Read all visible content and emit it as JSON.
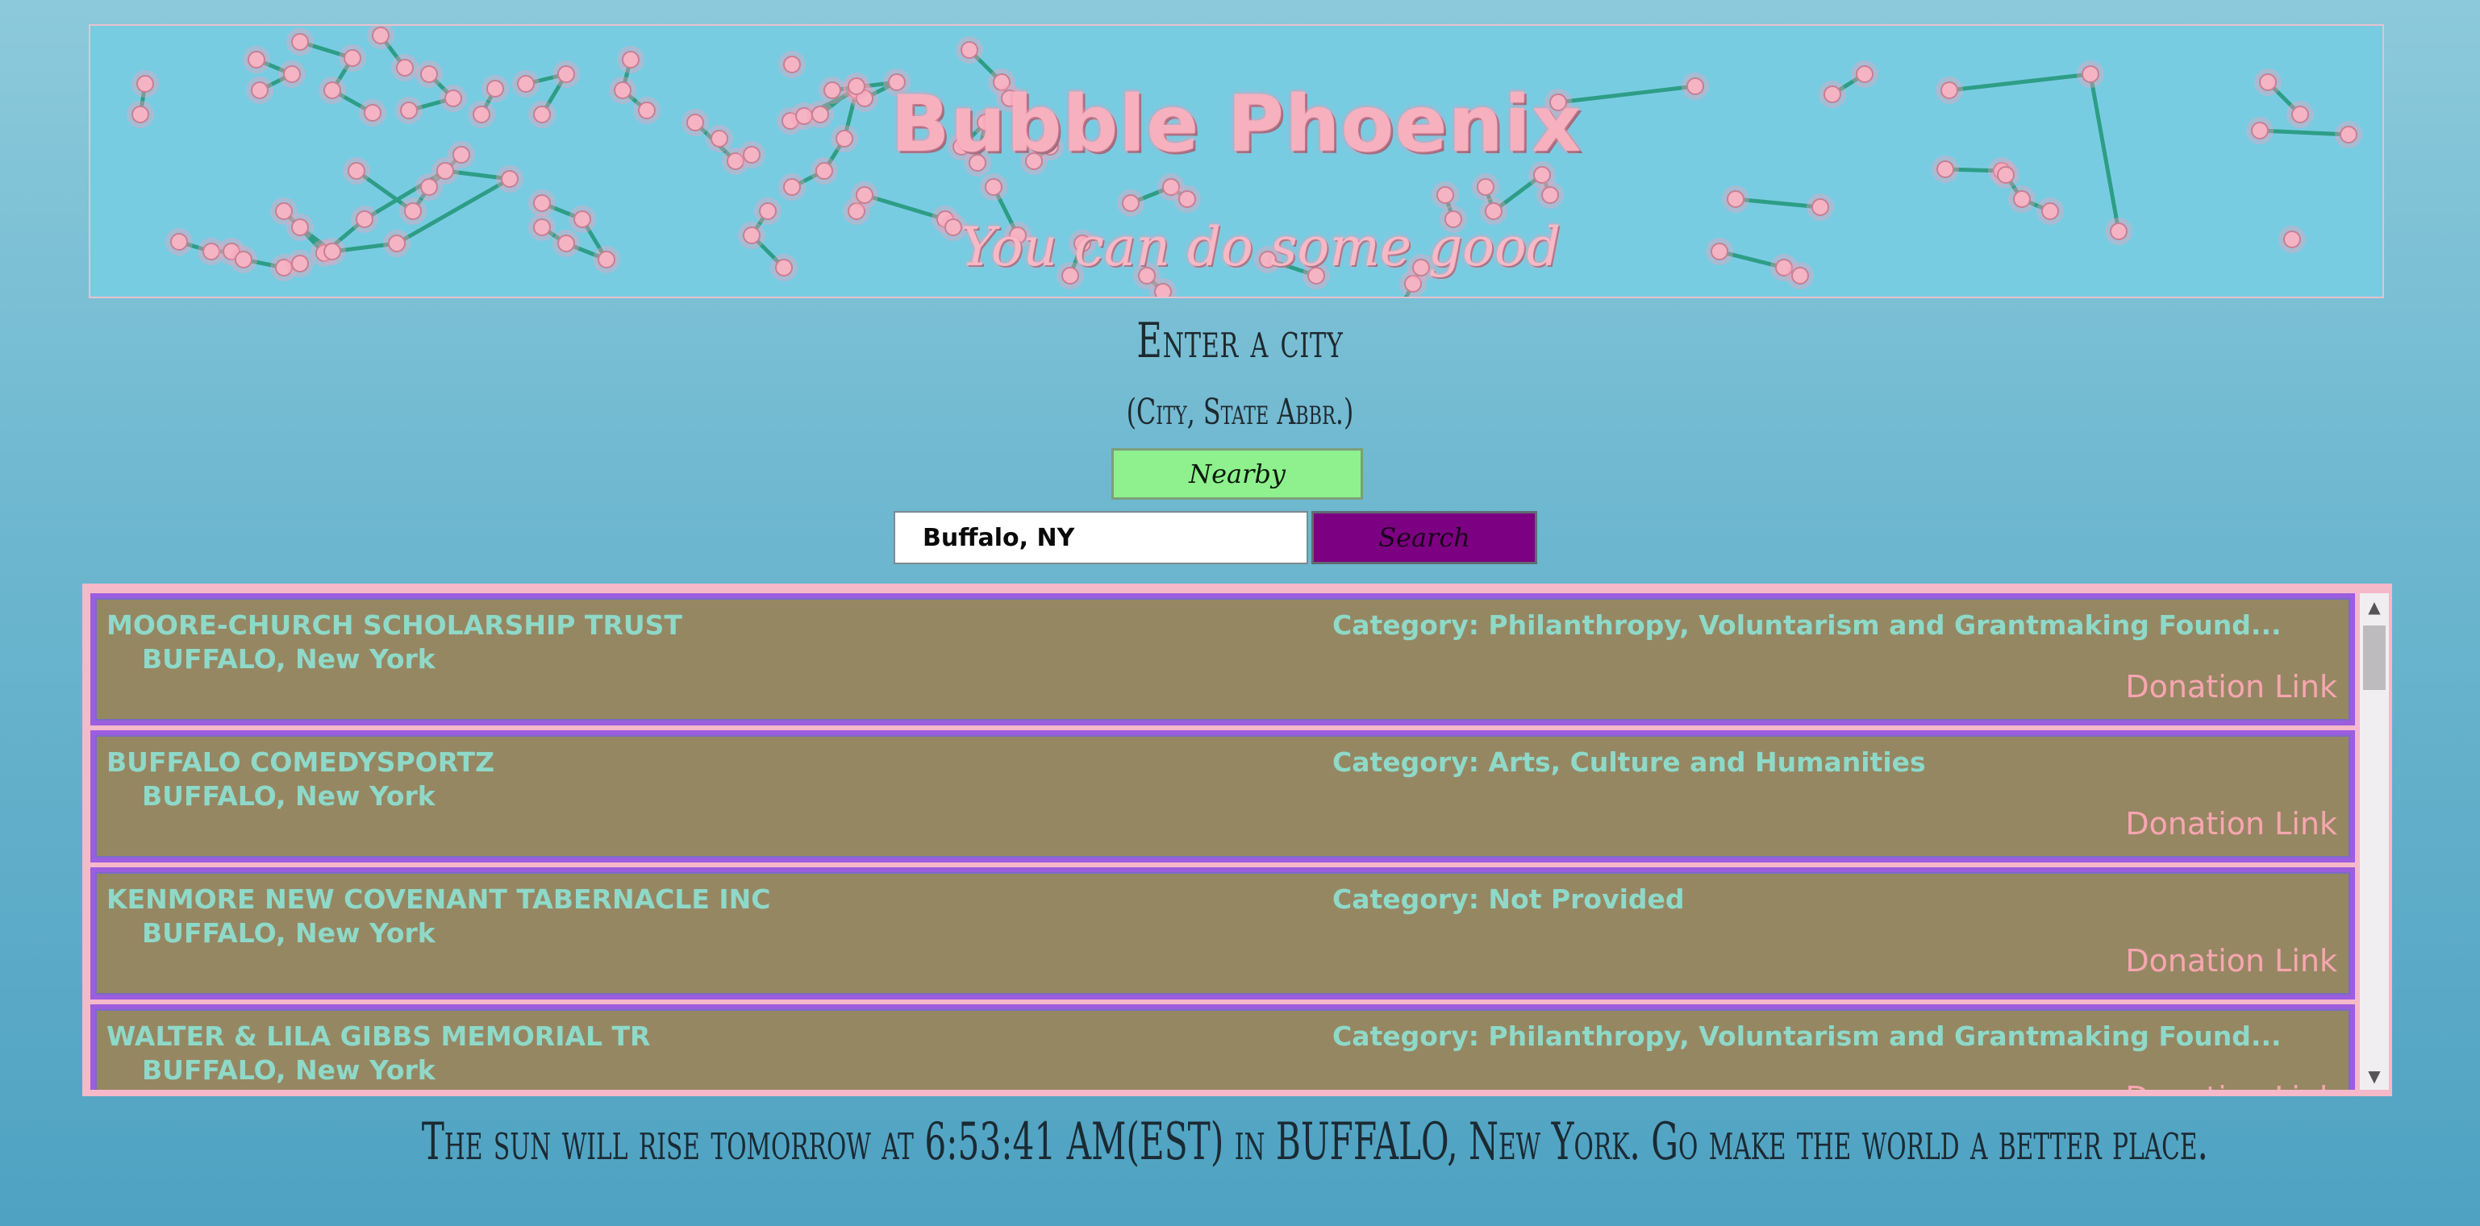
{
  "banner": {
    "title": "Bubble Phoenix",
    "tagline": "You can do some good"
  },
  "search_form": {
    "heading": "Enter a city",
    "hint": "(City, State Abbr.)",
    "nearby_label": "Nearby",
    "input_value": "Buffalo, NY",
    "search_label": "Search"
  },
  "results": [
    {
      "name": "MOORE-CHURCH SCHOLARSHIP TRUST",
      "location": "BUFFALO, New York",
      "category": "Category: Philanthropy, Voluntarism and Grantmaking Found...",
      "link_label": "Donation Link"
    },
    {
      "name": "BUFFALO COMEDYSPORTZ",
      "location": "BUFFALO, New York",
      "category": "Category: Arts, Culture and Humanities",
      "link_label": "Donation Link"
    },
    {
      "name": "KENMORE NEW COVENANT TABERNACLE INC",
      "location": "BUFFALO, New York",
      "category": "Category: Not Provided",
      "link_label": "Donation Link"
    },
    {
      "name": "WALTER & LILA GIBBS MEMORIAL TR",
      "location": "BUFFALO, New York",
      "category": "Category: Philanthropy, Voluntarism and Grantmaking Found...",
      "link_label": "Donation Link"
    }
  ],
  "footer": {
    "sunrise_text": "The sun will rise tomorrow at 6:53:41 AM(EST) in BUFFALO, New York. Go make the world a better place."
  },
  "colors": {
    "card_background": "#968763",
    "card_border": "#9c5dde",
    "card_text": "#8ed9c8",
    "donation_link": "#f7a6b0",
    "nearby_button": "#8ff08e",
    "search_button": "#7c0182",
    "results_frame": "#f5b9c9"
  }
}
